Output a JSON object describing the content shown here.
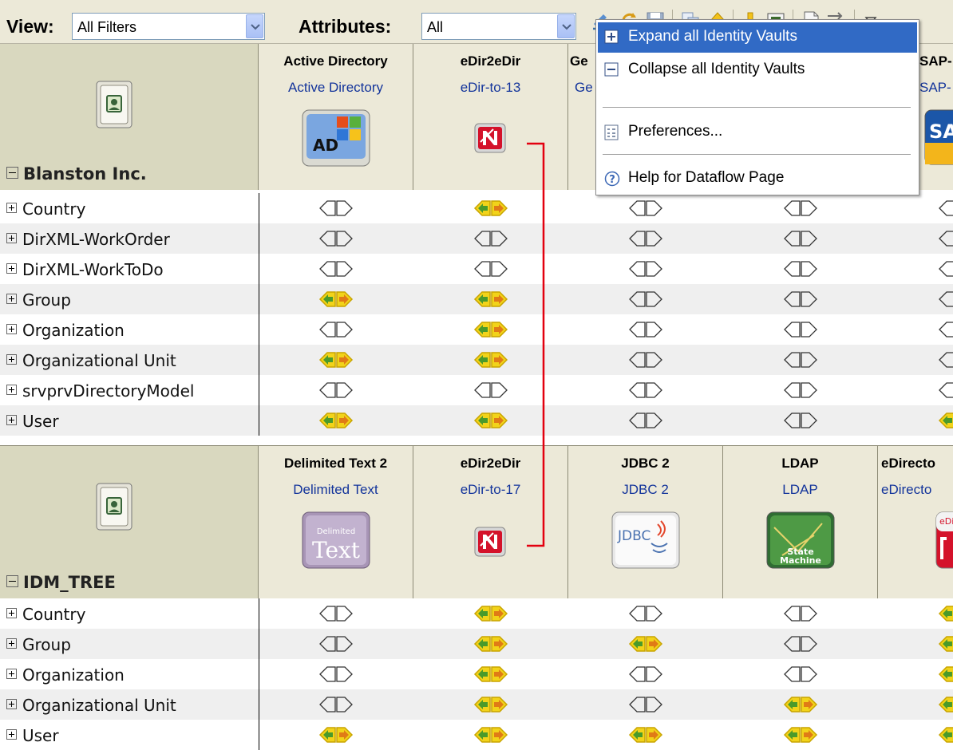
{
  "toolbar": {
    "view_label": "View:",
    "view_value": "All Filters",
    "attributes_label": "Attributes:",
    "attributes_value": "All",
    "icons": [
      "edit-icon",
      "refresh-icon",
      "save-icon",
      "copy-icon",
      "move-up-icon",
      "move-down-icon",
      "properties-icon",
      "document-icon",
      "flow-icon",
      "menu-icon"
    ]
  },
  "menu": {
    "items": [
      {
        "label": "Expand all Identity Vaults",
        "icon": "expand-icon",
        "selected": true
      },
      {
        "label": "Collapse all Identity Vaults",
        "icon": "collapse-icon"
      },
      {
        "label": "Preferences...",
        "icon": "preferences-icon"
      },
      {
        "label": "Help for Dataflow Page",
        "icon": "help-icon"
      }
    ]
  },
  "vaults": [
    {
      "name": "Blanston Inc.",
      "drivers": [
        {
          "name": "Active Directory",
          "desc": "Active Directory",
          "icon": "ad-icon"
        },
        {
          "name": "eDir2eDir",
          "desc": "eDir-to-13",
          "icon": "edir-icon"
        },
        {
          "name": "Ge",
          "desc": "Ge",
          "icon": ""
        },
        {
          "name": "",
          "desc": "",
          "icon": ""
        },
        {
          "name": "SAP-",
          "desc": "SAP-",
          "icon": "sap-icon"
        }
      ],
      "rows": [
        {
          "label": "Country",
          "flows": [
            0,
            1,
            0,
            0,
            0
          ]
        },
        {
          "label": "DirXML-WorkOrder",
          "flows": [
            0,
            0,
            0,
            0,
            0
          ]
        },
        {
          "label": "DirXML-WorkToDo",
          "flows": [
            0,
            0,
            0,
            0,
            0
          ]
        },
        {
          "label": "Group",
          "flows": [
            1,
            1,
            0,
            0,
            0
          ]
        },
        {
          "label": "Organization",
          "flows": [
            0,
            1,
            0,
            0,
            0
          ]
        },
        {
          "label": "Organizational Unit",
          "flows": [
            1,
            1,
            0,
            0,
            0
          ]
        },
        {
          "label": "srvprvDirectoryModel",
          "flows": [
            0,
            0,
            0,
            0,
            0
          ]
        },
        {
          "label": "User",
          "flows": [
            1,
            1,
            0,
            0,
            1
          ]
        }
      ]
    },
    {
      "name": "IDM_TREE",
      "drivers": [
        {
          "name": "Delimited Text 2",
          "desc": "Delimited Text",
          "icon": "delimited-text-icon",
          "icon_text": [
            "Delimited",
            "Text"
          ]
        },
        {
          "name": "eDir2eDir",
          "desc": "eDir-to-17",
          "icon": "edir-icon"
        },
        {
          "name": "JDBC 2",
          "desc": "JDBC 2",
          "icon": "jdbc-icon",
          "icon_text": "JDBC"
        },
        {
          "name": "LDAP",
          "desc": "LDAP",
          "icon": "ldap-icon",
          "icon_text": [
            "State",
            "Machine"
          ]
        },
        {
          "name": "eDirecto",
          "desc": "eDirecto",
          "icon": "edirectory-icon",
          "icon_text": "eDir"
        }
      ],
      "rows": [
        {
          "label": "Country",
          "flows": [
            0,
            1,
            0,
            0,
            1
          ]
        },
        {
          "label": "Group",
          "flows": [
            0,
            1,
            1,
            0,
            1
          ]
        },
        {
          "label": "Organization",
          "flows": [
            0,
            1,
            0,
            0,
            1
          ]
        },
        {
          "label": "Organizational Unit",
          "flows": [
            0,
            1,
            0,
            1,
            1
          ]
        },
        {
          "label": "User",
          "flows": [
            1,
            1,
            1,
            1,
            1
          ]
        }
      ]
    }
  ],
  "colors": {
    "flow_active": "#f2d31a",
    "flow_active_dark": "#c8a400",
    "connector_line": "#e3000f",
    "selection": "#316ac5"
  }
}
